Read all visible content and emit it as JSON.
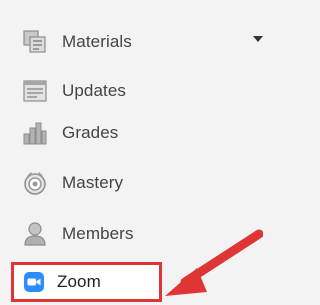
{
  "nav": {
    "items": [
      {
        "label": "Materials",
        "icon": "materials-icon"
      },
      {
        "label": "Updates",
        "icon": "updates-icon"
      },
      {
        "label": "Grades",
        "icon": "grades-icon"
      },
      {
        "label": "Mastery",
        "icon": "mastery-icon"
      },
      {
        "label": "Members",
        "icon": "members-icon"
      },
      {
        "label": "Zoom",
        "icon": "zoom-icon",
        "highlighted": true
      }
    ],
    "expand_indicator": "chevron-down-icon"
  },
  "annotation": {
    "highlight_color": "#e03535",
    "arrow_color": "#e03535"
  },
  "colors": {
    "background": "#f3f3f3",
    "text": "#444444",
    "icon_gray": "#9a9a9a",
    "zoom_blue": "#2d8cff"
  }
}
